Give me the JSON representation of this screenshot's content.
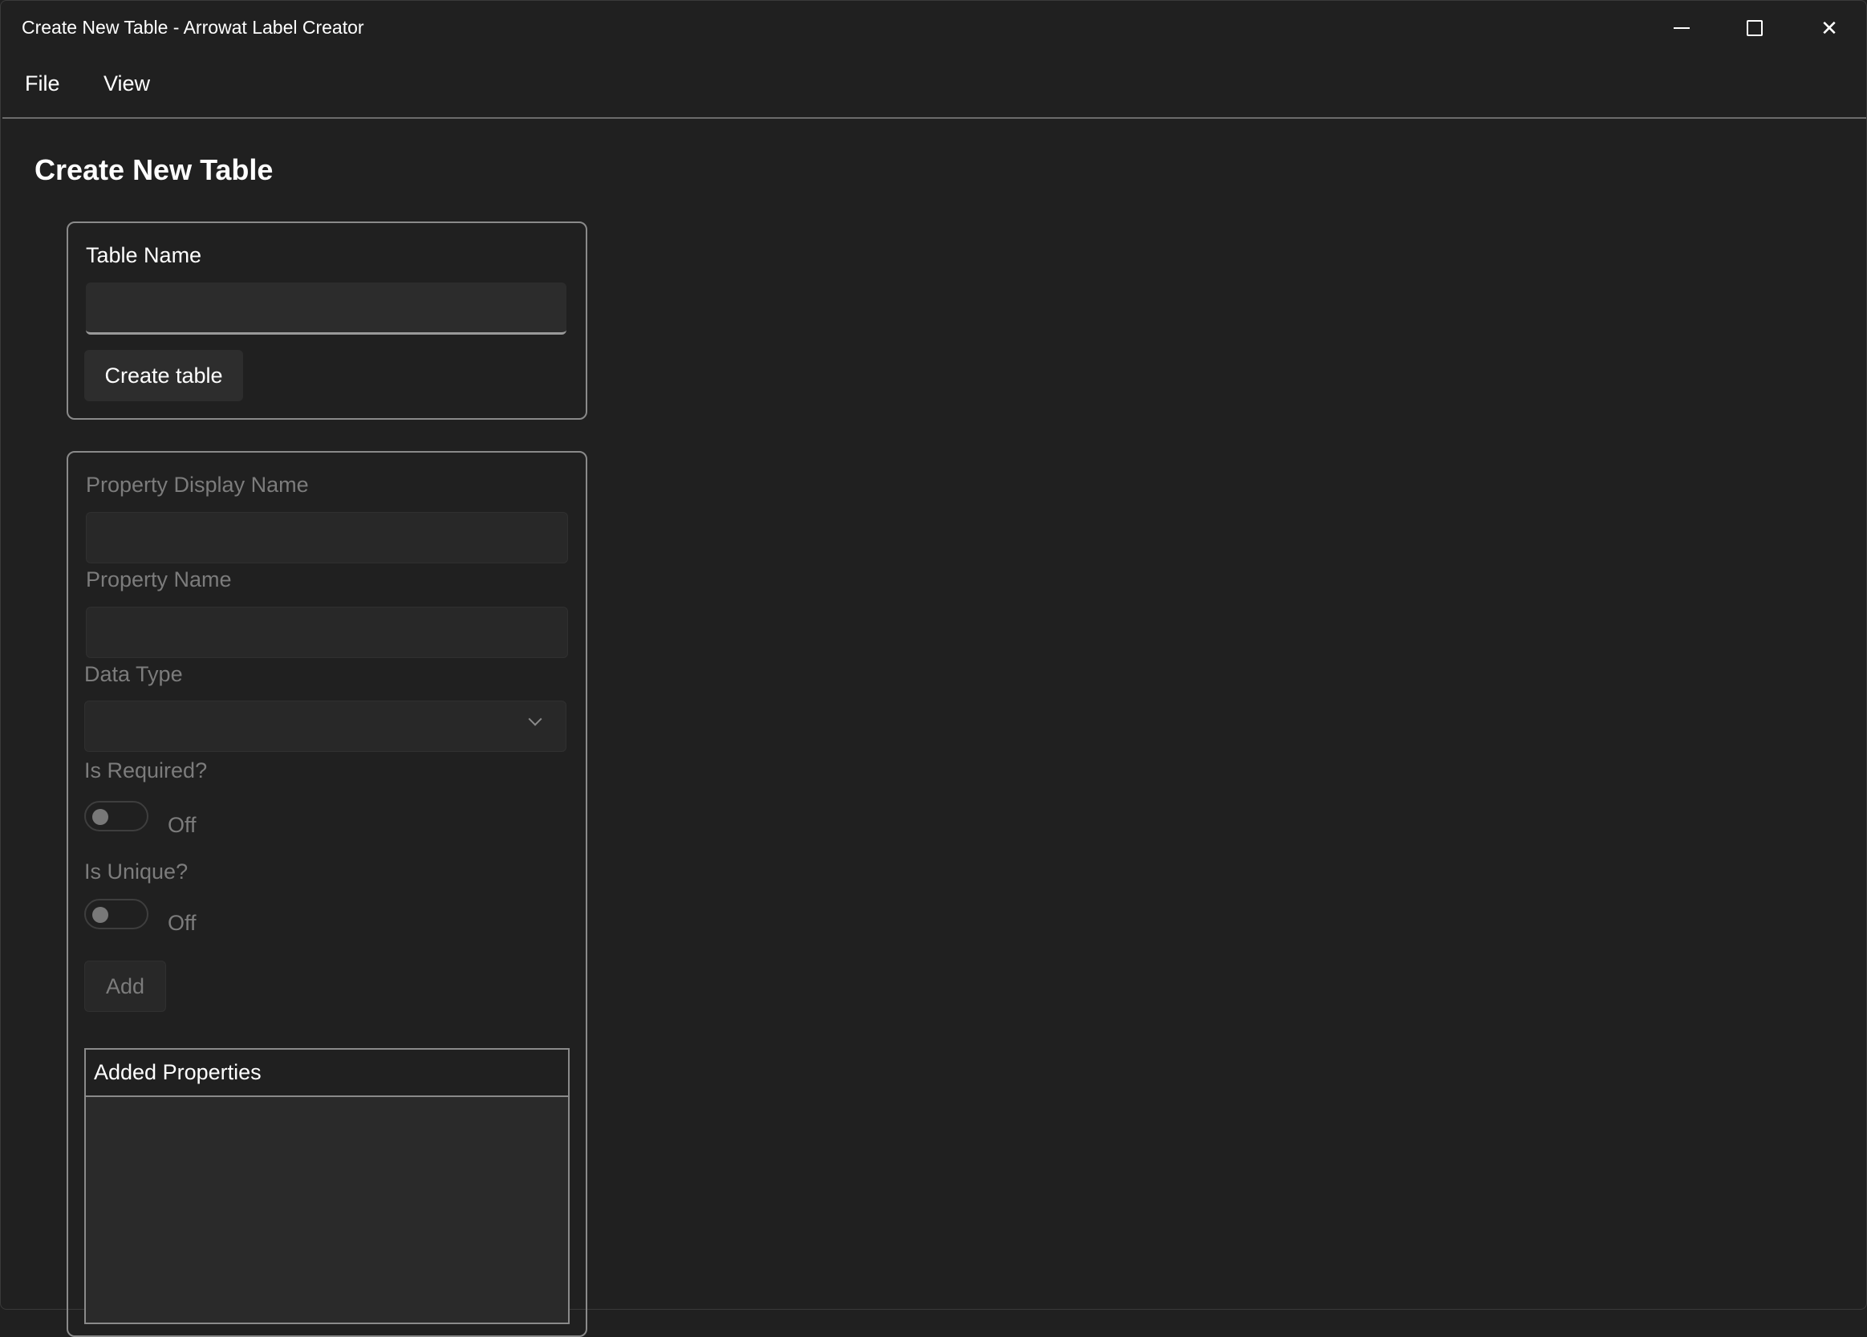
{
  "window": {
    "title": "Create New Table - Arrowat Label Creator",
    "controls": [
      "minimize-icon",
      "maximize-icon",
      "close-icon"
    ]
  },
  "menu": {
    "items": [
      "File",
      "View"
    ]
  },
  "page": {
    "title": "Create New Table"
  },
  "table_form": {
    "label": "Table Name",
    "value": "",
    "button": "Create table"
  },
  "property_form": {
    "display_name_label": "Property Display Name",
    "display_name_value": "",
    "name_label": "Property Name",
    "name_value": "",
    "data_type_label": "Data Type",
    "data_type_value": "",
    "required_label": "Is Required?",
    "required_state": "Off",
    "unique_label": "Is Unique?",
    "unique_state": "Off",
    "add_button": "Add",
    "enabled": false
  },
  "added_properties": {
    "header": "Added Properties",
    "rows": []
  }
}
